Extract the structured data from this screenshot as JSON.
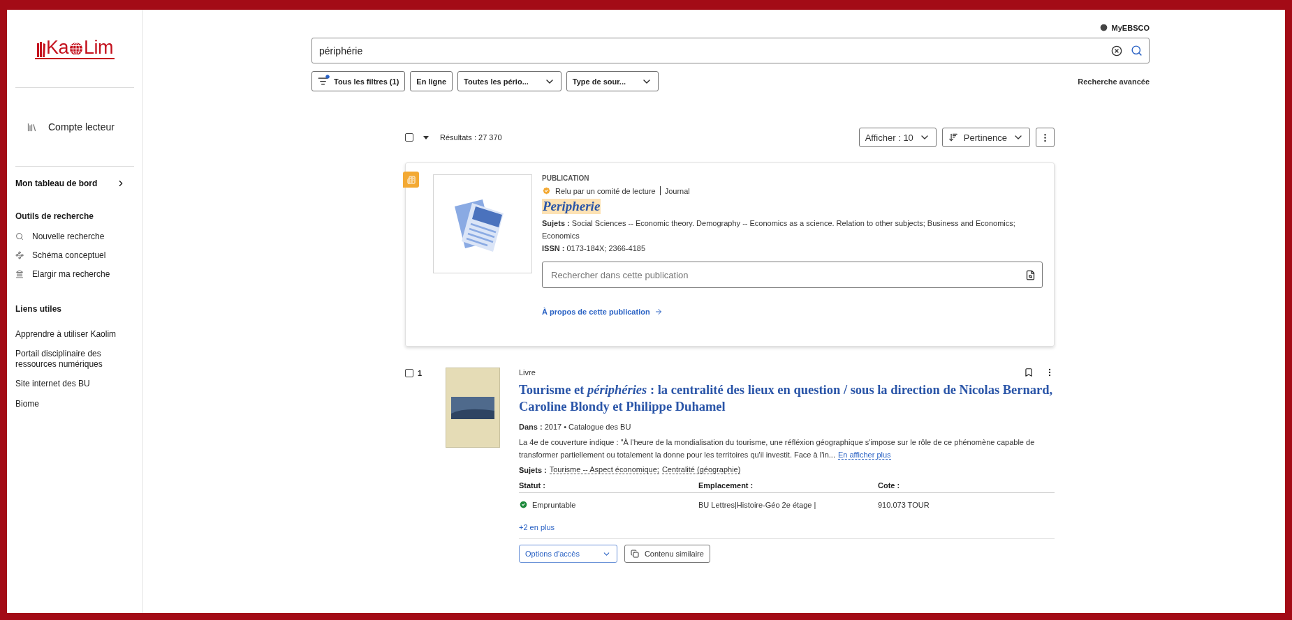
{
  "sidebar": {
    "logo": {
      "start": "Ka",
      "end": "Lim"
    },
    "account": "Compte lecteur",
    "dashboard": "Mon tableau de bord",
    "tools": {
      "heading": "Outils de recherche",
      "items": [
        {
          "label": "Nouvelle recherche",
          "kind": "search"
        },
        {
          "label": "Schéma conceptuel",
          "kind": "concept"
        },
        {
          "label": "Elargir ma recherche",
          "kind": "institution"
        }
      ]
    },
    "links": {
      "heading": "Liens utiles",
      "items": [
        "Apprendre à utiliser Kaolim",
        "Portail disciplinaire des ressources numériques",
        "Site internet des BU",
        "Biome"
      ]
    }
  },
  "header": {
    "account_link": "MyEBSCO",
    "search": {
      "value": "périphérie"
    },
    "filters": [
      {
        "label": "Tous les filtres (1)",
        "kind": "filter",
        "active": true
      },
      {
        "label": "En ligne",
        "kind": "plain"
      },
      {
        "label": "Toutes les pério...",
        "kind": "dropdown"
      },
      {
        "label": "Type de sour...",
        "kind": "dropdown"
      }
    ],
    "advanced_search": "Recherche avancée"
  },
  "results": {
    "select_all": {
      "checked": false
    },
    "count": "Résultats : 27 370",
    "page_size": "Afficher : 10",
    "sort": "Pertinence"
  },
  "publication": {
    "type": "PUBLICATION",
    "review": "Relu par un comité de lecture",
    "format": "Journal",
    "title": "Peripherie",
    "subjects": "**Sujets :** Social Sciences -- Economic theory. Demography -- Economics as a science. Relation to other subjects; Business and Economics; Economics",
    "issn": "**ISSN :** 0173-184X; 2366-4185",
    "search_placeholder": "Rechercher dans cette publication",
    "about": "À propos de cette publication"
  },
  "book": {
    "number": "1",
    "checked": false,
    "type": "Livre",
    "title": "Tourisme et *périphéries* : la centralité des lieux en question / sous la direction de Nicolas Bernard, Caroline Blondy et Philippe Duhamel",
    "source": "**Dans :** 2017 • Catalogue des BU",
    "abstract": "La 4e de couverture indique : \"À l'heure de la mondialisation du tourisme, une réfléxion géographique s'impose sur le rôle de ce phénomène capable de transformer partiellement ou totalement la donne pour les territoires qu'il investit. Face à l'in...",
    "more": "En afficher plus",
    "subjects_label": "Sujets :",
    "subjects": [
      "Tourisme -- Aspect économique;",
      "Centralité (géographie)"
    ],
    "columns": [
      "Statut :",
      "Emplacement :",
      "Cote :"
    ],
    "rows": [
      {
        "available": true,
        "cells": [
          "Empruntable",
          "BU Lettres|Histoire-Géo 2e étage |",
          "910.073 TOUR"
        ]
      }
    ],
    "extra": "+2 en plus",
    "actions": [
      {
        "label": "Options d'accès",
        "kind": "dropdown"
      },
      {
        "label": "Contenu similaire",
        "kind": "similar"
      }
    ]
  }
}
